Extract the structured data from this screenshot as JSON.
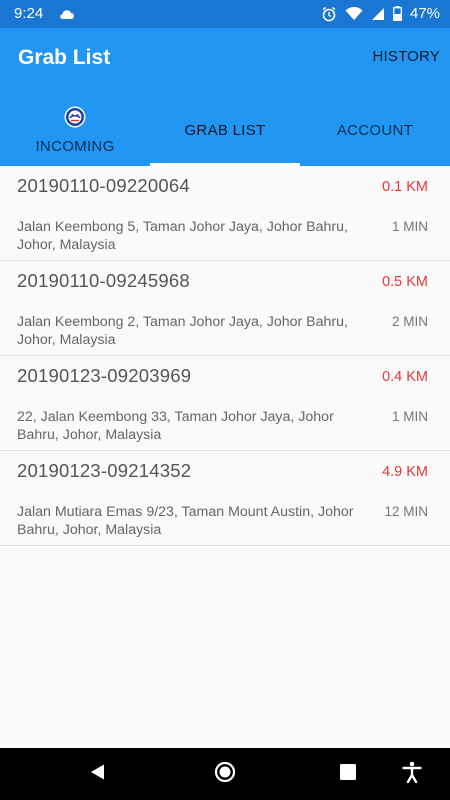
{
  "status_bar": {
    "time": "9:24",
    "battery": "47%",
    "icons": [
      "cloud-icon",
      "alarm-icon",
      "wifi-icon",
      "signal-icon",
      "battery-icon"
    ]
  },
  "app_bar": {
    "title": "Grab List",
    "history_label": "HISTORY"
  },
  "tabs": [
    {
      "label": "INCOMING",
      "icon": "logo-icon"
    },
    {
      "label": "GRAB LIST",
      "active": true
    },
    {
      "label": "ACCOUNT"
    }
  ],
  "orders": [
    {
      "id": "20190110-09220064",
      "distance": "0.1 KM",
      "address": "Jalan Keembong 5, Taman Johor Jaya, Johor Bahru, Johor, Malaysia",
      "eta": "1 MIN"
    },
    {
      "id": "20190110-09245968",
      "distance": "0.5 KM",
      "address": "Jalan Keembong 2, Taman Johor Jaya, Johor Bahru, Johor, Malaysia",
      "eta": "2 MIN"
    },
    {
      "id": "20190123-09203969",
      "distance": "0.4 KM",
      "address": "22, Jalan Keembong 33, Taman Johor Jaya, Johor Bahru, Johor, Malaysia",
      "eta": "1 MIN"
    },
    {
      "id": "20190123-09214352",
      "distance": "4.9 KM",
      "address": "Jalan Mutiara Emas 9/23, Taman Mount Austin, Johor Bahru, Johor, Malaysia",
      "eta": "12 MIN"
    }
  ],
  "nav_bar": {
    "buttons": [
      "back-icon",
      "home-icon",
      "recents-icon",
      "accessibility-icon"
    ]
  },
  "colors": {
    "primary": "#2196f3",
    "status_bar": "#1976d2",
    "distance": "#e53935"
  }
}
